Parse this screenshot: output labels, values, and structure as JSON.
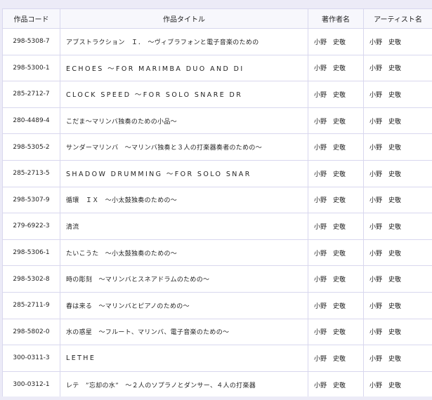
{
  "table": {
    "headers": {
      "code": "作品コード",
      "title": "作品タイトル",
      "author": "著作者名",
      "artist": "アーティスト名"
    },
    "rows": [
      {
        "code": "298-5308-7",
        "title": "アブストラクション　Ｉ．　〜ヴィブラフォンと電子音楽のための",
        "author": "小野　史敬",
        "artist": "小野　史敬"
      },
      {
        "code": "298-5300-1",
        "title": "ECHOES 〜FOR MARIMBA DUO AND DI",
        "author": "小野　史敬",
        "artist": "小野　史敬"
      },
      {
        "code": "285-2712-7",
        "title": "CLOCK SPEED 〜FOR SOLO SNARE DR",
        "author": "小野　史敬",
        "artist": "小野　史敬"
      },
      {
        "code": "280-4489-4",
        "title": "こだま〜マリンバ独奏のための小品〜",
        "author": "小野　史敬",
        "artist": "小野　史敬"
      },
      {
        "code": "298-5305-2",
        "title": "サンダーマリンバ　〜マリンバ独奏と３人の打楽器奏者のための〜",
        "author": "小野　史敬",
        "artist": "小野　史敬"
      },
      {
        "code": "285-2713-5",
        "title": "SHADOW DRUMMING 〜FOR SOLO SNAR",
        "author": "小野　史敬",
        "artist": "小野　史敬"
      },
      {
        "code": "298-5307-9",
        "title": "循環　ＩＸ　〜小太鼓独奏のための〜",
        "author": "小野　史敬",
        "artist": "小野　史敬"
      },
      {
        "code": "279-6922-3",
        "title": "清流",
        "author": "小野　史敬",
        "artist": "小野　史敬"
      },
      {
        "code": "298-5306-1",
        "title": "たいこうた　〜小太鼓独奏のための〜",
        "author": "小野　史敬",
        "artist": "小野　史敬"
      },
      {
        "code": "298-5302-8",
        "title": "時の彫刻　〜マリンバとスネアドラムのための〜",
        "author": "小野　史敬",
        "artist": "小野　史敬"
      },
      {
        "code": "285-2711-9",
        "title": "春は来る　〜マリンバとピアノのための〜",
        "author": "小野　史敬",
        "artist": "小野　史敬"
      },
      {
        "code": "298-5802-0",
        "title": "水の惑星　〜フルート、マリンバ、電子音楽のための〜",
        "author": "小野　史敬",
        "artist": "小野　史敬"
      },
      {
        "code": "300-0311-3",
        "title": "LETHE",
        "author": "小野　史敬",
        "artist": "小野　史敬"
      },
      {
        "code": "300-0312-1",
        "title": "レテ　”忘却の水”　〜２人のソプラノとダンサー、４人の打楽器",
        "author": "小野　史敬",
        "artist": "小野　史敬"
      }
    ]
  }
}
